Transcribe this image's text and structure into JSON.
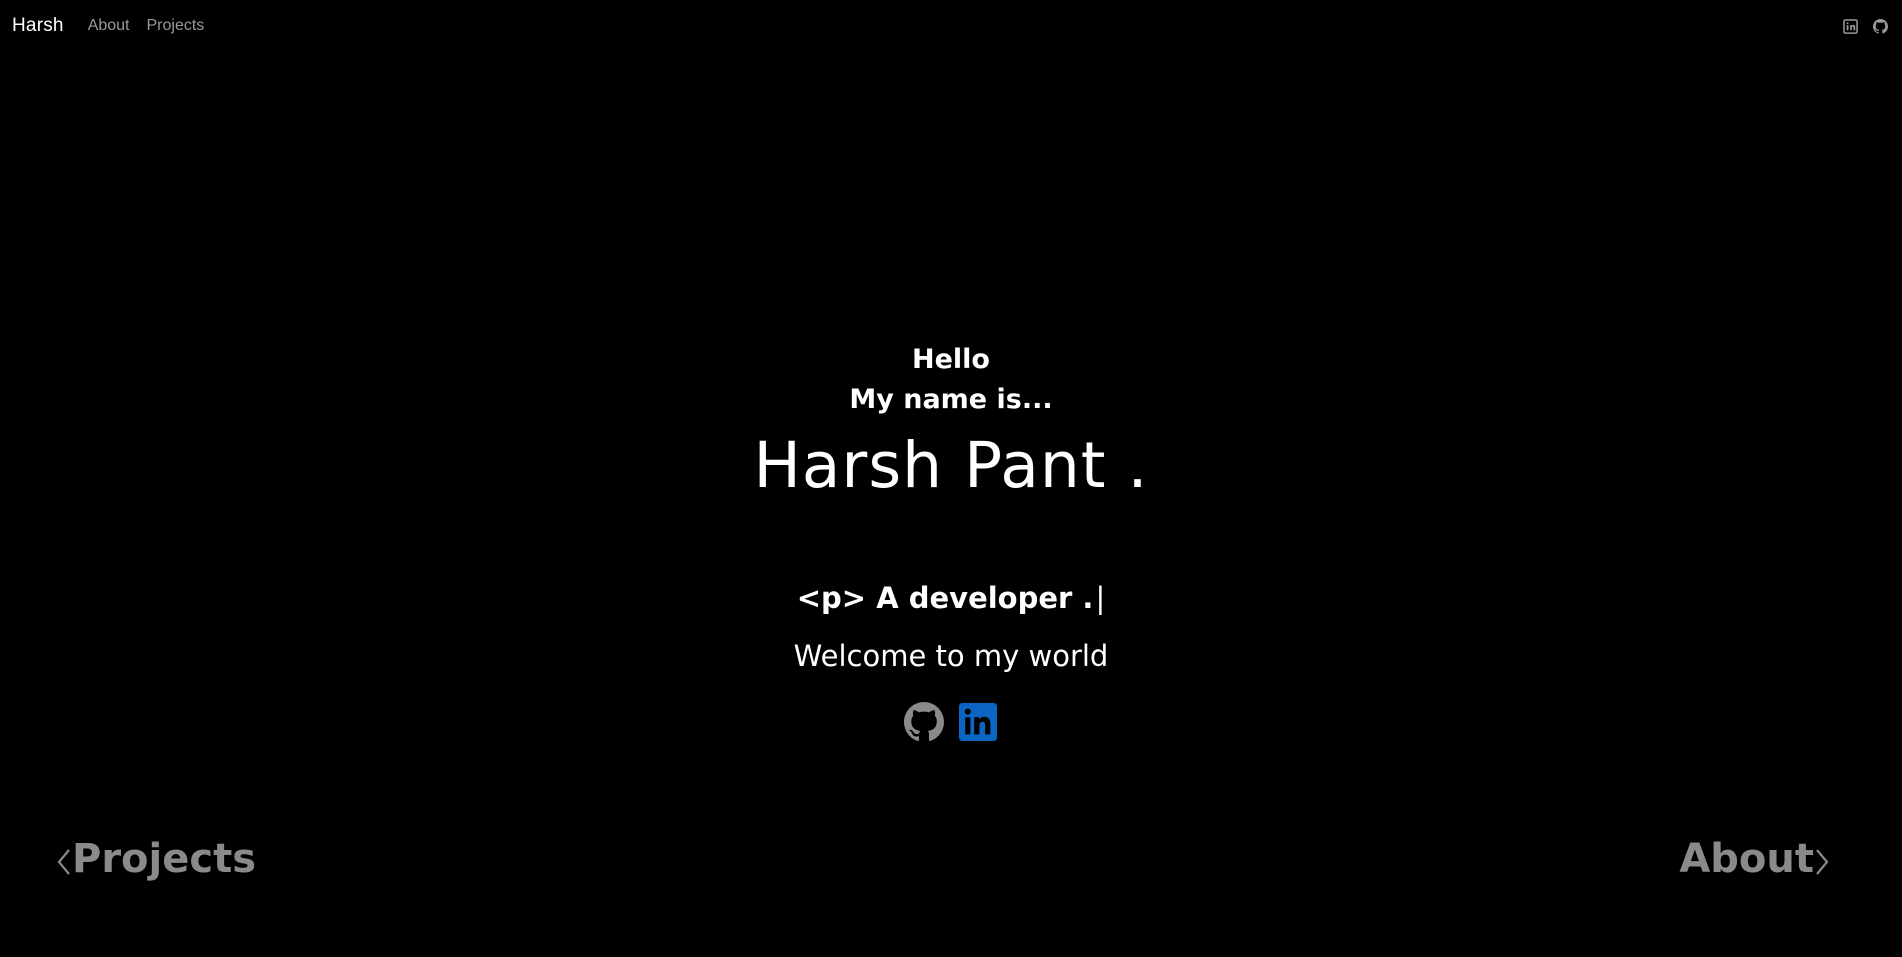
{
  "navbar": {
    "brand": "Harsh",
    "links": [
      "About",
      "Projects"
    ],
    "icons": [
      "linkedin-icon",
      "github-icon"
    ]
  },
  "hero": {
    "greeting": "Hello",
    "intro": "My name is...",
    "name": "Harsh Pant .",
    "typing_text": "<p> A developer .",
    "cursor": "|",
    "welcome": "Welcome to my world"
  },
  "socials": {
    "icons": [
      "github-icon",
      "linkedin-icon"
    ],
    "colors": {
      "github": "#8a8a8a",
      "linkedin": "#0a66c2"
    }
  },
  "pager": {
    "prev_label": "Projects",
    "next_label": "About"
  },
  "colors": {
    "background": "#000000",
    "text": "#ffffff",
    "muted": "#9a9a9a",
    "pager": "#8a8a8a"
  }
}
